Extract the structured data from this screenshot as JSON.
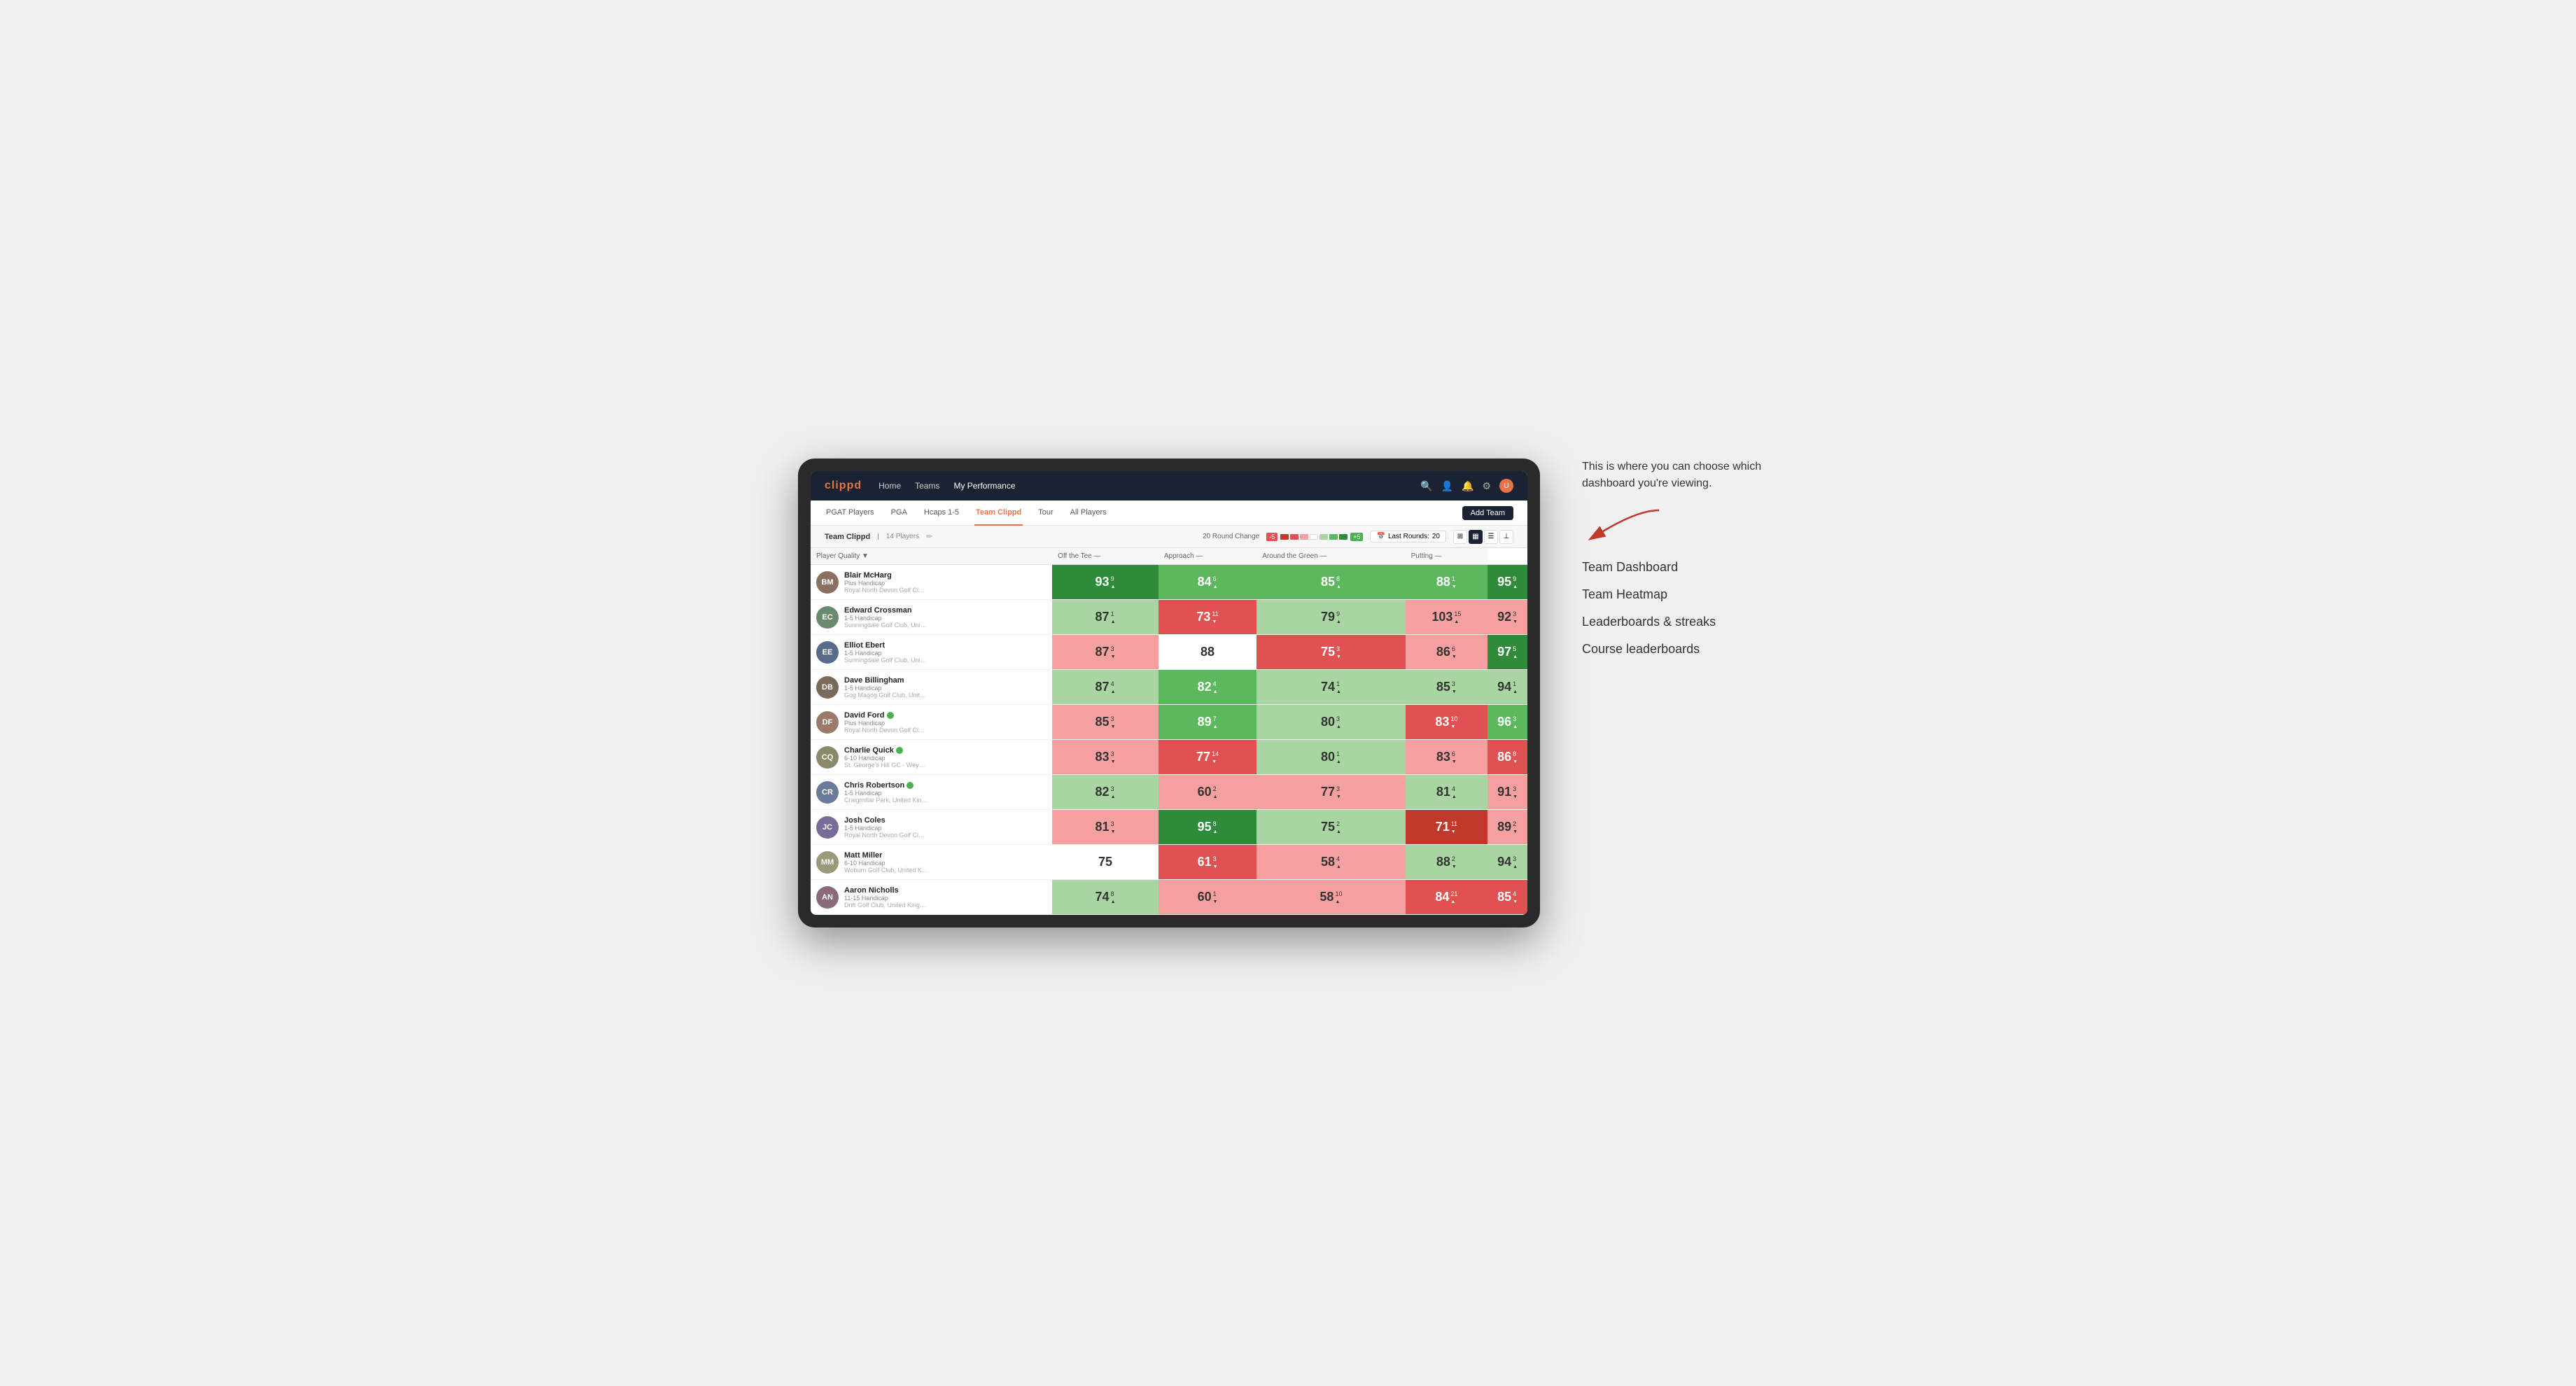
{
  "annotation": {
    "intro_text": "This is where you can choose which dashboard you're viewing.",
    "items": [
      {
        "label": "Team Dashboard"
      },
      {
        "label": "Team Heatmap"
      },
      {
        "label": "Leaderboards & streaks"
      },
      {
        "label": "Course leaderboards"
      }
    ]
  },
  "nav": {
    "logo": "clippd",
    "links": [
      "Home",
      "Teams",
      "My Performance"
    ],
    "active_link": "My Performance"
  },
  "sub_nav": {
    "links": [
      "PGAT Players",
      "PGA",
      "Hcaps 1-5",
      "Team Clippd",
      "Tour",
      "All Players"
    ],
    "active_link": "Team Clippd",
    "add_team_label": "Add Team"
  },
  "team_bar": {
    "team_name": "Team Clippd",
    "separator": "|",
    "player_count": "14 Players",
    "round_change_label": "20 Round Change",
    "change_neg": "-5",
    "change_pos": "+5",
    "last_rounds_label": "Last Rounds:",
    "last_rounds_value": "20"
  },
  "table": {
    "headers": [
      "Player Quality ▼",
      "Off the Tee —",
      "Approach —",
      "Around the Green —",
      "Putting —"
    ],
    "players": [
      {
        "name": "Blair McHarg",
        "hcap": "Plus Handicap",
        "club": "Royal North Devon Golf Club, United Kingdom",
        "avatar_color": "#8a7060",
        "initials": "BM",
        "scores": [
          {
            "value": 93,
            "change": "9",
            "dir": "up",
            "bg": "bg-green-strong"
          },
          {
            "value": 84,
            "change": "6",
            "dir": "up",
            "bg": "bg-green-med"
          },
          {
            "value": 85,
            "change": "8",
            "dir": "up",
            "bg": "bg-green-med"
          },
          {
            "value": 88,
            "change": "1",
            "dir": "down",
            "bg": "bg-green-med"
          },
          {
            "value": 95,
            "change": "9",
            "dir": "up",
            "bg": "bg-green-strong"
          }
        ]
      },
      {
        "name": "Edward Crossman",
        "hcap": "1-5 Handicap",
        "club": "Sunningdale Golf Club, United Kingdom",
        "avatar_color": "#6a8a70",
        "initials": "EC",
        "scores": [
          {
            "value": 87,
            "change": "1",
            "dir": "up",
            "bg": "bg-green-light"
          },
          {
            "value": 73,
            "change": "11",
            "dir": "down",
            "bg": "bg-red-med"
          },
          {
            "value": 79,
            "change": "9",
            "dir": "up",
            "bg": "bg-green-light"
          },
          {
            "value": 103,
            "change": "15",
            "dir": "up",
            "bg": "bg-red-light"
          },
          {
            "value": 92,
            "change": "3",
            "dir": "down",
            "bg": "bg-red-light"
          }
        ]
      },
      {
        "name": "Elliot Ebert",
        "hcap": "1-5 Handicap",
        "club": "Sunningdale Golf Club, United Kingdom",
        "avatar_color": "#5a6a8a",
        "initials": "EE",
        "scores": [
          {
            "value": 87,
            "change": "3",
            "dir": "down",
            "bg": "bg-red-light"
          },
          {
            "value": 88,
            "change": "",
            "dir": "",
            "bg": "bg-white"
          },
          {
            "value": 75,
            "change": "3",
            "dir": "down",
            "bg": "bg-red-med"
          },
          {
            "value": 86,
            "change": "6",
            "dir": "down",
            "bg": "bg-red-light"
          },
          {
            "value": 97,
            "change": "5",
            "dir": "up",
            "bg": "bg-green-strong"
          }
        ]
      },
      {
        "name": "Dave Billingham",
        "hcap": "1-5 Handicap",
        "club": "Gog Magog Golf Club, United Kingdom",
        "avatar_color": "#7a6a5a",
        "initials": "DB",
        "scores": [
          {
            "value": 87,
            "change": "4",
            "dir": "up",
            "bg": "bg-green-light"
          },
          {
            "value": 82,
            "change": "4",
            "dir": "up",
            "bg": "bg-green-med"
          },
          {
            "value": 74,
            "change": "1",
            "dir": "up",
            "bg": "bg-green-light"
          },
          {
            "value": 85,
            "change": "3",
            "dir": "down",
            "bg": "bg-green-light"
          },
          {
            "value": 94,
            "change": "1",
            "dir": "up",
            "bg": "bg-green-light"
          }
        ]
      },
      {
        "name": "David Ford",
        "hcap": "Plus Handicap",
        "club": "Royal North Devon Golf Club, United Kingdom",
        "avatar_color": "#9a7a6a",
        "initials": "DF",
        "verified": true,
        "scores": [
          {
            "value": 85,
            "change": "3",
            "dir": "down",
            "bg": "bg-red-light"
          },
          {
            "value": 89,
            "change": "7",
            "dir": "up",
            "bg": "bg-green-med"
          },
          {
            "value": 80,
            "change": "3",
            "dir": "up",
            "bg": "bg-green-light"
          },
          {
            "value": 83,
            "change": "10",
            "dir": "down",
            "bg": "bg-red-med"
          },
          {
            "value": 96,
            "change": "3",
            "dir": "up",
            "bg": "bg-green-med"
          }
        ]
      },
      {
        "name": "Charlie Quick",
        "hcap": "6-10 Handicap",
        "club": "St. George's Hill GC - Weybridge - Surrey, Uni...",
        "avatar_color": "#8a8a6a",
        "initials": "CQ",
        "verified": true,
        "scores": [
          {
            "value": 83,
            "change": "3",
            "dir": "down",
            "bg": "bg-red-light"
          },
          {
            "value": 77,
            "change": "14",
            "dir": "down",
            "bg": "bg-red-med"
          },
          {
            "value": 80,
            "change": "1",
            "dir": "up",
            "bg": "bg-green-light"
          },
          {
            "value": 83,
            "change": "6",
            "dir": "down",
            "bg": "bg-red-light"
          },
          {
            "value": 86,
            "change": "8",
            "dir": "down",
            "bg": "bg-red-med"
          }
        ]
      },
      {
        "name": "Chris Robertson",
        "hcap": "1-5 Handicap",
        "club": "Craigmillar Park, United Kingdom",
        "avatar_color": "#6a7a9a",
        "initials": "CR",
        "verified": true,
        "scores": [
          {
            "value": 82,
            "change": "3",
            "dir": "up",
            "bg": "bg-green-light"
          },
          {
            "value": 60,
            "change": "2",
            "dir": "up",
            "bg": "bg-red-light"
          },
          {
            "value": 77,
            "change": "3",
            "dir": "down",
            "bg": "bg-red-light"
          },
          {
            "value": 81,
            "change": "4",
            "dir": "up",
            "bg": "bg-green-light"
          },
          {
            "value": 91,
            "change": "3",
            "dir": "down",
            "bg": "bg-red-light"
          }
        ]
      },
      {
        "name": "Josh Coles",
        "hcap": "1-5 Handicap",
        "club": "Royal North Devon Golf Club, United Kingdom",
        "avatar_color": "#7a6a9a",
        "initials": "JC",
        "scores": [
          {
            "value": 81,
            "change": "3",
            "dir": "down",
            "bg": "bg-red-light"
          },
          {
            "value": 95,
            "change": "8",
            "dir": "up",
            "bg": "bg-green-strong"
          },
          {
            "value": 75,
            "change": "2",
            "dir": "up",
            "bg": "bg-green-light"
          },
          {
            "value": 71,
            "change": "11",
            "dir": "down",
            "bg": "bg-red-strong"
          },
          {
            "value": 89,
            "change": "2",
            "dir": "down",
            "bg": "bg-red-light"
          }
        ]
      },
      {
        "name": "Matt Miller",
        "hcap": "6-10 Handicap",
        "club": "Woburn Golf Club, United Kingdom",
        "avatar_color": "#9a9a7a",
        "initials": "MM",
        "scores": [
          {
            "value": 75,
            "change": "",
            "dir": "",
            "bg": "bg-white"
          },
          {
            "value": 61,
            "change": "3",
            "dir": "down",
            "bg": "bg-red-med"
          },
          {
            "value": 58,
            "change": "4",
            "dir": "up",
            "bg": "bg-red-light"
          },
          {
            "value": 88,
            "change": "2",
            "dir": "down",
            "bg": "bg-green-light"
          },
          {
            "value": 94,
            "change": "3",
            "dir": "up",
            "bg": "bg-green-light"
          }
        ]
      },
      {
        "name": "Aaron Nicholls",
        "hcap": "11-15 Handicap",
        "club": "Drift Golf Club, United Kingdom",
        "avatar_color": "#8a6a7a",
        "initials": "AN",
        "scores": [
          {
            "value": 74,
            "change": "8",
            "dir": "up",
            "bg": "bg-green-light"
          },
          {
            "value": 60,
            "change": "1",
            "dir": "down",
            "bg": "bg-red-light"
          },
          {
            "value": 58,
            "change": "10",
            "dir": "up",
            "bg": "bg-red-light"
          },
          {
            "value": 84,
            "change": "21",
            "dir": "up",
            "bg": "bg-red-med"
          },
          {
            "value": 85,
            "change": "4",
            "dir": "down",
            "bg": "bg-red-med"
          }
        ]
      }
    ]
  }
}
